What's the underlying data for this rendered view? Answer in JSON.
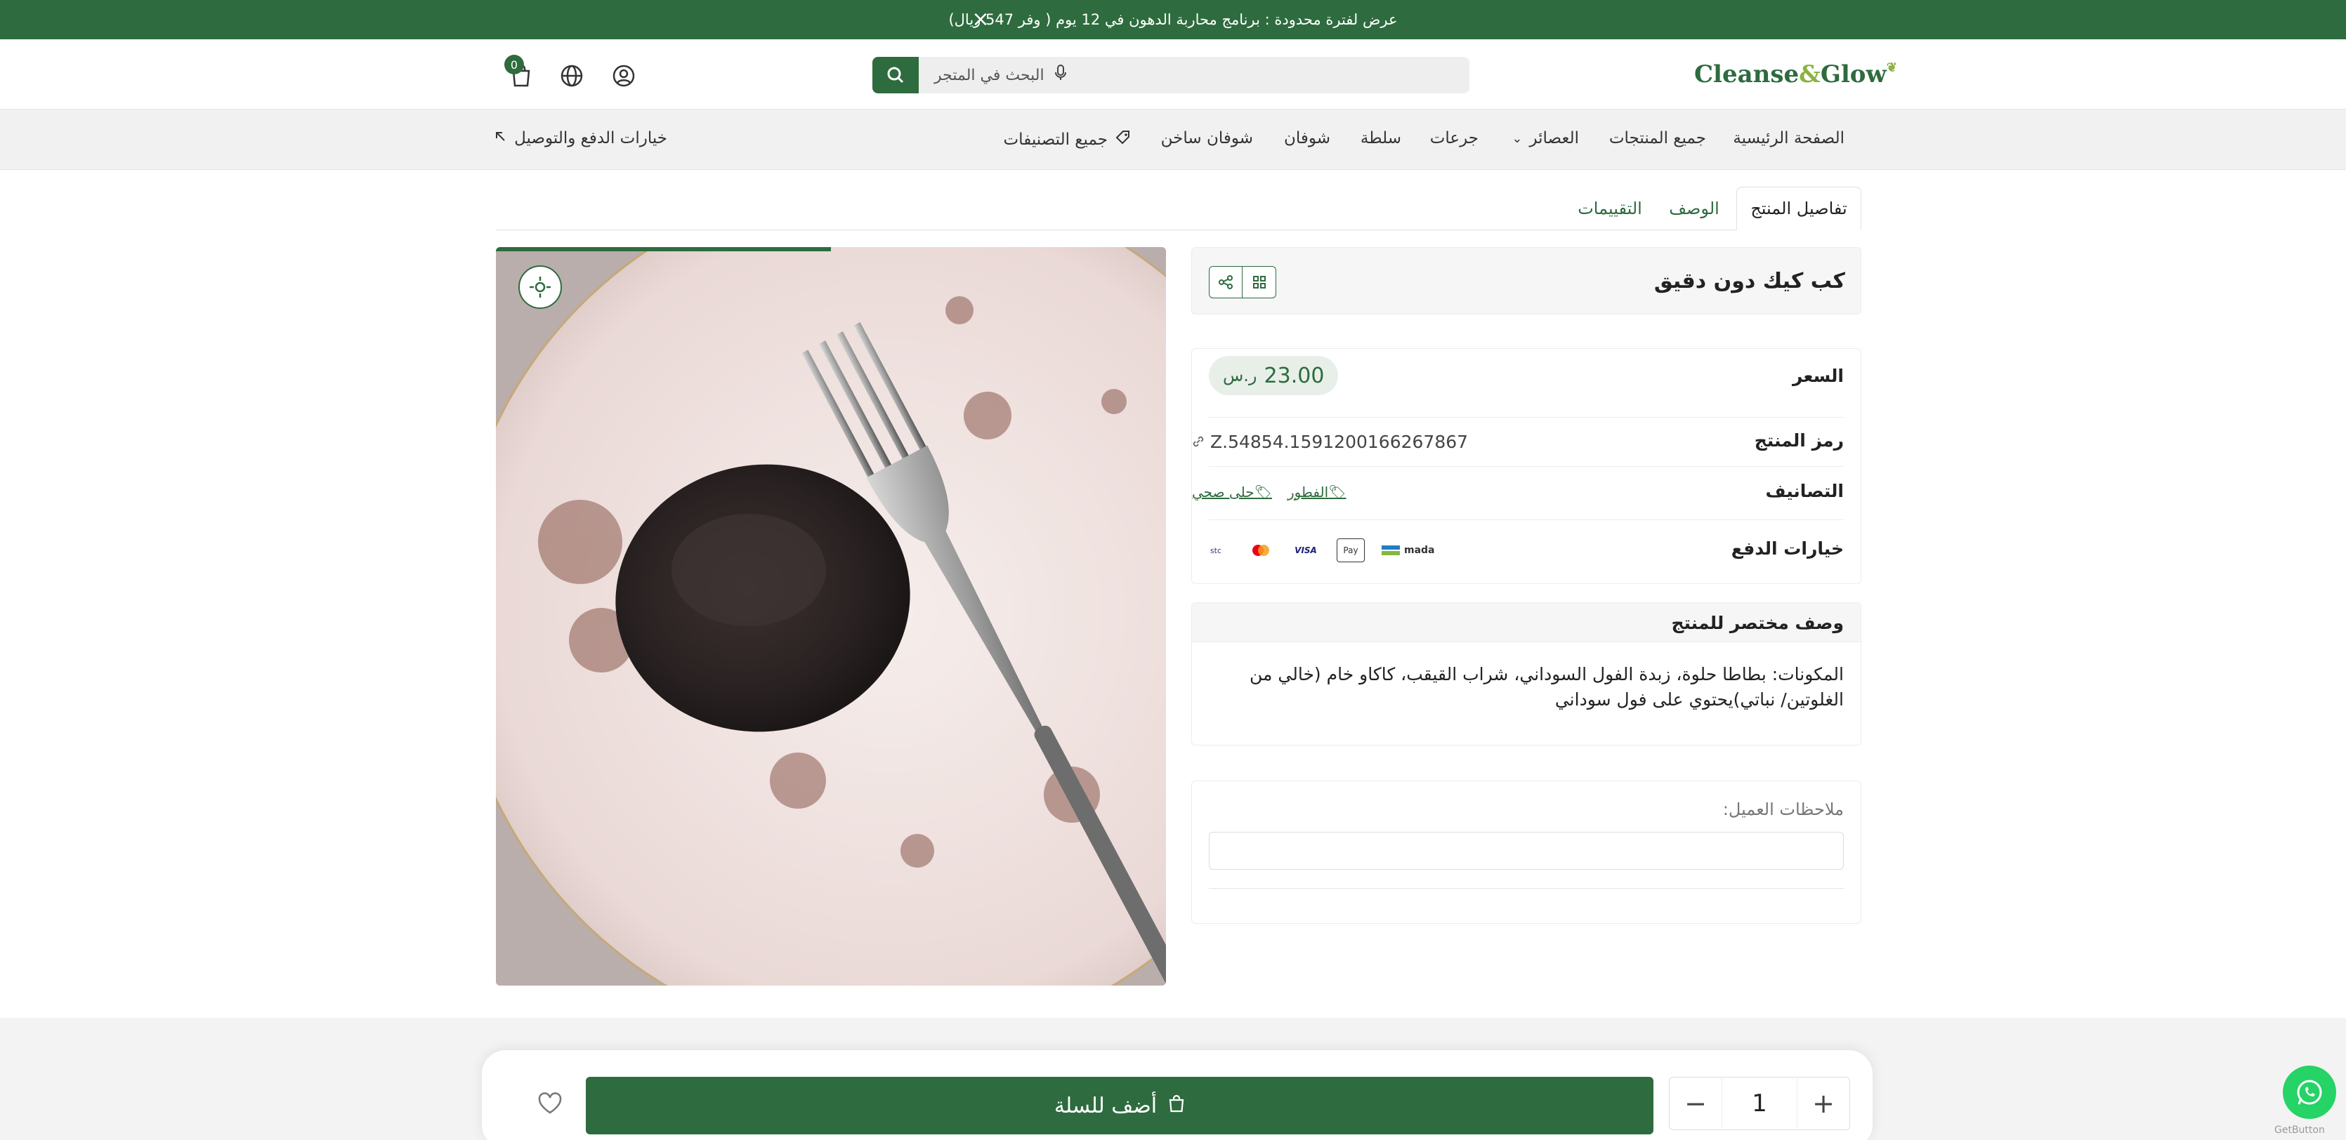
{
  "promo": {
    "text": "عرض لفترة محدودة : برنامج محاربة الدهون في 12 يوم ( وفر 547 ريال)"
  },
  "header": {
    "logo_main": "Cleanse",
    "logo_amp": "&",
    "logo_end": "Glow",
    "search_placeholder": "البحث في المتجر",
    "cart_count": "0"
  },
  "nav": {
    "items": [
      {
        "label": "الصفحة الرئيسية"
      },
      {
        "label": "جميع المنتجات"
      },
      {
        "label": "العصائر"
      },
      {
        "label": "جرعات"
      },
      {
        "label": "سلطة"
      },
      {
        "label": "شوفان"
      },
      {
        "label": "شوفان ساخن"
      },
      {
        "label": "جميع التصنيفات"
      }
    ],
    "payment_link": "خيارات الدفع والتوصيل"
  },
  "tabs": [
    {
      "label": "تفاصيل المنتج"
    },
    {
      "label": "الوصف"
    },
    {
      "label": "التقييمات"
    }
  ],
  "image": {
    "slider_progress": 0.5
  },
  "product": {
    "title": "كب كيك دون دقيق",
    "price_label": "السعر",
    "price": "23.00",
    "currency_symbol": "ر.س",
    "sku_label": "رمز المنتج",
    "sku": "Z.54854.1591200166267867",
    "categories_label": "التصانيف",
    "categories": [
      "الفطور",
      "حلى صحي"
    ],
    "payment_label": "خيارات الدفع",
    "payment_methods": [
      "mada",
      "Pay",
      "VISA",
      "mastercard",
      "stc"
    ]
  },
  "description": {
    "heading": "وصف مختصر للمنتج",
    "text": "المكونات: بطاطا حلوة، زبدة الفول السوداني، شراب القيقب، كاكاو خام (خالي من الغلوتين/ نباتي)يحتوي على فول سوداني"
  },
  "notes": {
    "label": "ملاحظات العميل:"
  },
  "cart_bar": {
    "quantity": "1",
    "add_label": "أضف للسلة"
  },
  "footer": {
    "getbutton": "GetButton"
  },
  "colors": {
    "primary": "#2e6b3e",
    "accent": "#8bb340",
    "whatsapp": "#25d366"
  }
}
